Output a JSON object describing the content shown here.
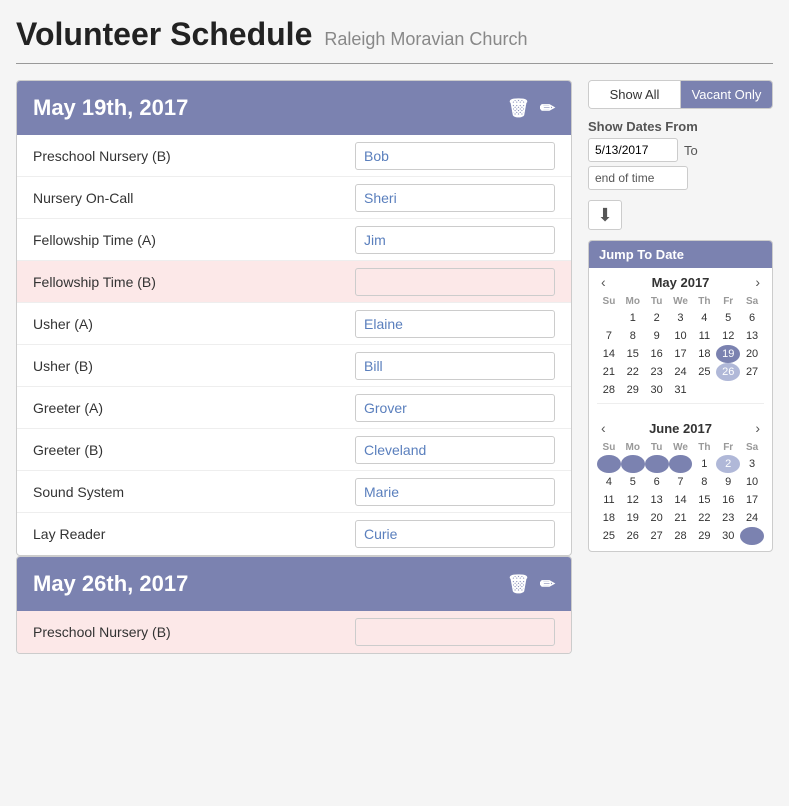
{
  "header": {
    "title": "Volunteer Schedule",
    "subtitle": "Raleigh Moravian Church"
  },
  "filter": {
    "show_all_label": "Show All",
    "vacant_only_label": "Vacant Only",
    "active": "vacant_only"
  },
  "date_filter": {
    "label": "Show Dates From",
    "from_value": "5/13/2017",
    "to_label": "To",
    "end_value": "end of time"
  },
  "jump_to_date_label": "Jump To Date",
  "calendars": [
    {
      "month_year": "May 2017",
      "days_header": [
        "Su",
        "Mo",
        "Tu",
        "We",
        "Th",
        "Fr",
        "Sa"
      ],
      "weeks": [
        [
          "",
          "1",
          "2",
          "3",
          "4",
          "5",
          "6"
        ],
        [
          "7",
          "8",
          "9",
          "10",
          "11",
          "12",
          "13"
        ],
        [
          "14",
          "15",
          "16",
          "17",
          "18",
          "19",
          "20"
        ],
        [
          "21",
          "22",
          "23",
          "24",
          "25",
          "26",
          "27"
        ],
        [
          "28",
          "29",
          "30",
          "31",
          "",
          "",
          ""
        ]
      ],
      "today": "19",
      "selected": "26"
    },
    {
      "month_year": "June 2017",
      "days_header": [
        "Su",
        "Mo",
        "Tu",
        "We",
        "Th",
        "Fr",
        "Sa"
      ],
      "weeks": [
        [
          "",
          "",
          "",
          "",
          "1",
          "2",
          "3"
        ],
        [
          "4",
          "5",
          "6",
          "7",
          "8",
          "9",
          "10"
        ],
        [
          "11",
          "12",
          "13",
          "14",
          "15",
          "16",
          "17"
        ],
        [
          "18",
          "19",
          "20",
          "21",
          "22",
          "23",
          "24"
        ],
        [
          "25",
          "26",
          "27",
          "28",
          "29",
          "30",
          ""
        ]
      ],
      "today": "",
      "selected": "2"
    }
  ],
  "schedules": [
    {
      "date": "May 19th, 2017",
      "rows": [
        {
          "label": "Preschool Nursery (B)",
          "value": "Bob",
          "vacant": false
        },
        {
          "label": "Nursery On-Call",
          "value": "Sheri",
          "vacant": false
        },
        {
          "label": "Fellowship Time (A)",
          "value": "Jim",
          "vacant": false
        },
        {
          "label": "Fellowship Time (B)",
          "value": "",
          "vacant": true
        },
        {
          "label": "Usher (A)",
          "value": "Elaine",
          "vacant": false
        },
        {
          "label": "Usher (B)",
          "value": "Bill",
          "vacant": false
        },
        {
          "label": "Greeter (A)",
          "value": "Grover",
          "vacant": false
        },
        {
          "label": "Greeter (B)",
          "value": "Cleveland",
          "vacant": false
        },
        {
          "label": "Sound System",
          "value": "Marie",
          "vacant": false
        },
        {
          "label": "Lay Reader",
          "value": "Curie",
          "vacant": false
        }
      ]
    },
    {
      "date": "May 26th, 2017",
      "rows": [
        {
          "label": "Preschool Nursery (B)",
          "value": "",
          "vacant": true
        }
      ]
    }
  ]
}
